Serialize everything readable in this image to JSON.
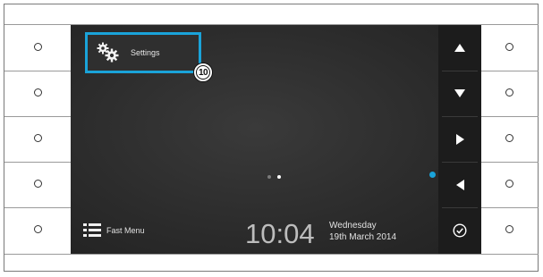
{
  "screen": {
    "settings_tile": {
      "label": "Settings",
      "icon": "gears-icon"
    },
    "callout_badge": "10",
    "page_indicator": {
      "pages": 2,
      "current": 2
    },
    "fast_menu": {
      "label": "Fast Menu",
      "icon": "menu-list-icon"
    },
    "clock": {
      "time": "10:04",
      "day": "Wednesday",
      "date": "19th March 2014"
    },
    "nav_buttons": [
      "up-arrow-icon",
      "down-arrow-icon",
      "right-arrow-icon",
      "left-arrow-icon",
      "check-circle-icon"
    ]
  },
  "colors": {
    "accent": "#1aa3d9",
    "screen_bg": "#2b2b2b",
    "nav_bg": "#1c1c1c"
  }
}
